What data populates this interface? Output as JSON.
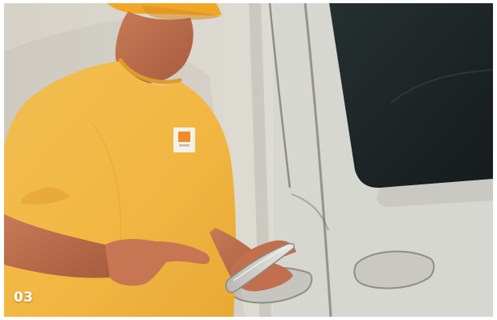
{
  "image": {
    "caption_number": "03",
    "subject": "person-using-phone-next-to-van",
    "colors": {
      "shirt": "#f2b742",
      "cap": "#f0a727",
      "van": "#d8d7d2",
      "window": "#1f2627",
      "phone": "#c8c3bc"
    }
  }
}
